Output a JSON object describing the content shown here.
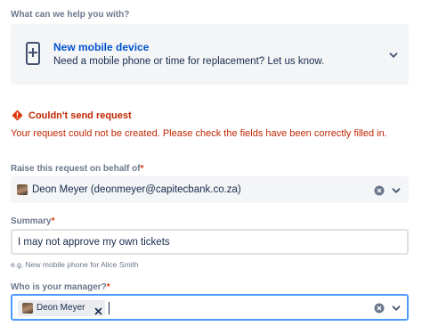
{
  "request_type": {
    "label": "What can we help you with?",
    "title": "New mobile device",
    "description": "Need a mobile phone or time for replacement? Let us know.",
    "icon": "mobile-device-icon"
  },
  "error": {
    "title": "Couldn't send request",
    "message": "Your request could not be created. Please check the fields have been correctly filled in.",
    "color": "#bf2600"
  },
  "on_behalf": {
    "label": "Raise this request on behalf of",
    "required_mark": "*",
    "value": "Deon Meyer (deonmeyer@capitecbank.co.za)"
  },
  "summary": {
    "label": "Summary",
    "required_mark": "*",
    "value": "I may not approve my own tickets",
    "helper": "e.g. New mobile phone for Alice Smith"
  },
  "manager": {
    "label": "Who is your manager?",
    "required_mark": "*",
    "chip_label": "Deon Meyer"
  },
  "colors": {
    "accent": "#0052cc",
    "focus_border": "#4c9aff",
    "required": "#de350b",
    "field_bg": "#f4f5f7"
  }
}
